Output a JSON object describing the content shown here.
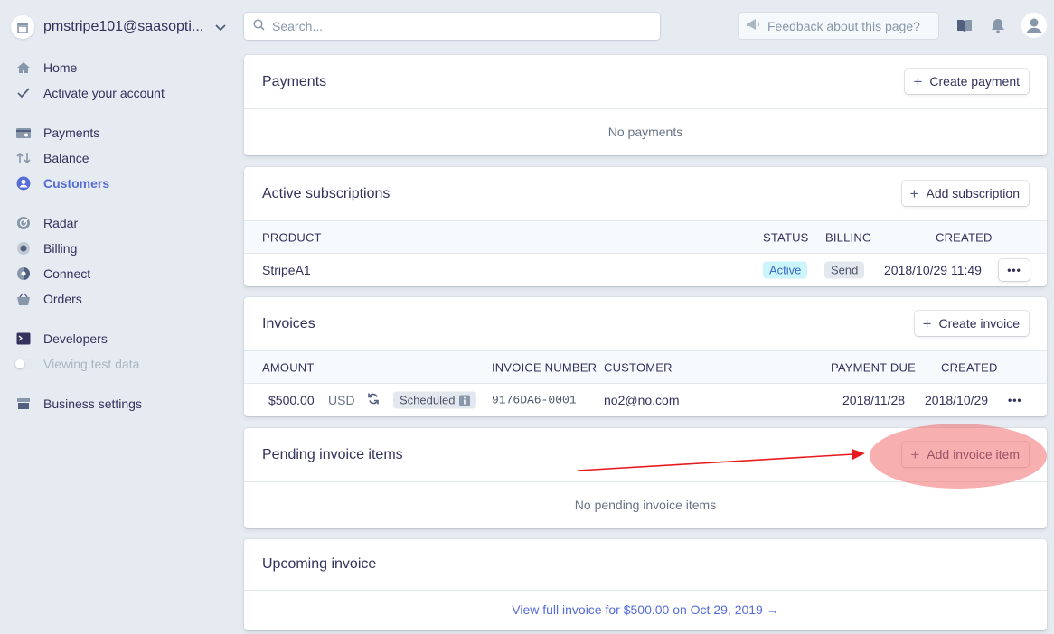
{
  "account": {
    "name": "pmstripe101@saasopti..."
  },
  "search": {
    "placeholder": "Search..."
  },
  "feedback": {
    "label": "Feedback about this page?"
  },
  "nav": [
    {
      "label": "Home",
      "icon": "home-icon"
    },
    {
      "label": "Activate your account",
      "icon": "check-icon"
    },
    {
      "label": "Payments",
      "icon": "payments-icon"
    },
    {
      "label": "Balance",
      "icon": "balance-icon"
    },
    {
      "label": "Customers",
      "icon": "customers-icon",
      "active": true
    },
    {
      "label": "Radar",
      "icon": "radar-icon"
    },
    {
      "label": "Billing",
      "icon": "billing-icon"
    },
    {
      "label": "Connect",
      "icon": "connect-icon"
    },
    {
      "label": "Orders",
      "icon": "orders-icon"
    },
    {
      "label": "Developers",
      "icon": "terminal-icon"
    },
    {
      "label": "Viewing test data",
      "icon": "toggle-icon"
    },
    {
      "label": "Business settings",
      "icon": "store-icon"
    }
  ],
  "payments": {
    "title": "Payments",
    "button": "Create payment",
    "empty": "No payments"
  },
  "subscriptions": {
    "title": "Active subscriptions",
    "button": "Add subscription",
    "headers": {
      "product": "PRODUCT",
      "status": "STATUS",
      "billing": "BILLING",
      "created": "CREATED"
    },
    "rows": [
      {
        "product": "StripeA1",
        "status": "Active",
        "billing": "Send",
        "created": "2018/10/29 11:49"
      }
    ]
  },
  "invoices": {
    "title": "Invoices",
    "button": "Create invoice",
    "headers": {
      "amount": "AMOUNT",
      "number": "INVOICE NUMBER",
      "customer": "CUSTOMER",
      "due": "PAYMENT DUE",
      "created": "CREATED"
    },
    "rows": [
      {
        "amount": "$500.00",
        "currency": "USD",
        "status": "Scheduled",
        "number": "9176DA6-0001",
        "customer": "no2@no.com",
        "due": "2018/11/28",
        "created": "2018/10/29"
      }
    ]
  },
  "pending": {
    "title": "Pending invoice items",
    "button": "Add invoice item",
    "empty": "No pending invoice items"
  },
  "upcoming": {
    "title": "Upcoming invoice",
    "link": "View full invoice for $500.00 on Oct 29, 2019 →"
  },
  "colors": {
    "accent": "#556cd6",
    "annotation": "#f06e6e",
    "arrow": "#e8191e"
  }
}
